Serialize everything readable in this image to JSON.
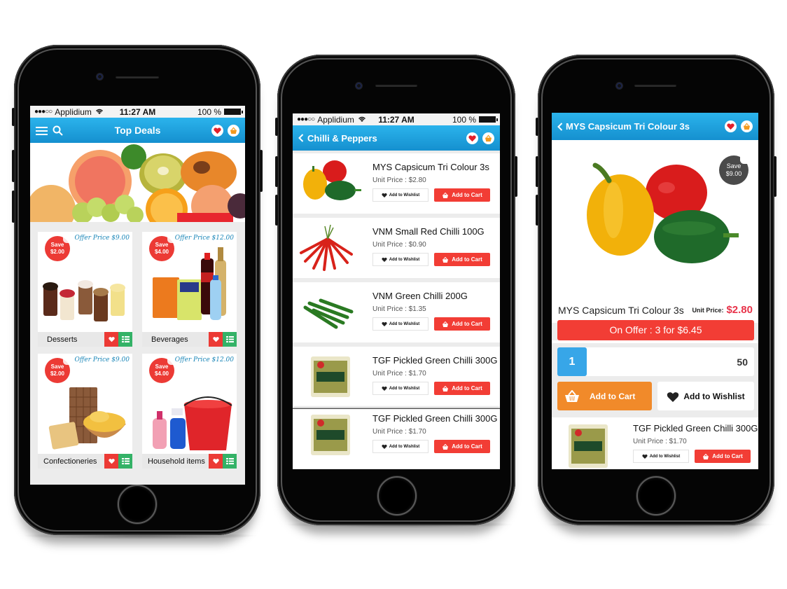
{
  "statusbar": {
    "signal": "●●●○○",
    "carrier": "Applidium",
    "time": "11:27 AM",
    "battery": "100 %"
  },
  "phone1": {
    "nav": {
      "title": "Top Deals",
      "menu_icon": "hamburger-menu-icon",
      "search_icon": "search-icon",
      "wishlist_icon": "heart-icon",
      "cart_icon": "basket-icon"
    },
    "tiles": [
      {
        "name": "Desserts",
        "offer": "Offer Price $9.00",
        "save_label": "Save",
        "save_amount": "$2.00"
      },
      {
        "name": "Beverages",
        "offer": "Offer Price $12.00",
        "save_label": "Save",
        "save_amount": "$4.00"
      },
      {
        "name": "Confectioneries",
        "offer": "Offer Price $9.00",
        "save_label": "Save",
        "save_amount": "$2.00"
      },
      {
        "name": "Household items",
        "offer": "Offer Price $12.00",
        "save_label": "Save",
        "save_amount": "$4.00"
      }
    ]
  },
  "phone2": {
    "nav": {
      "back": "<",
      "title": "Chilli & Peppers"
    },
    "products": [
      {
        "name": "MYS Capsicum Tri Colour 3s",
        "price": "Unit Price : $2.80",
        "wish": "Add to Wishlist",
        "cart": "Add to Cart"
      },
      {
        "name": "VNM Small Red Chilli 100G",
        "price": "Unit Price : $0.90",
        "wish": "Add to Wishlist",
        "cart": "Add to Cart"
      },
      {
        "name": "VNM Green Chilli 200G",
        "price": "Unit Price : $1.35",
        "wish": "Add to Wishlist",
        "cart": "Add to Cart"
      },
      {
        "name": "TGF Pickled Green Chilli 300G",
        "price": "Unit Price : $1.70",
        "wish": "Add to Wishlist",
        "cart": "Add to Cart"
      },
      {
        "name": "TGF Pickled Green Chilli 300G",
        "price": "Unit Price : $1.70",
        "wish": "Add to Wishlist",
        "cart": "Add to Cart"
      }
    ]
  },
  "phone3": {
    "nav": {
      "back": "<",
      "title": "MYS Capsicum Tri Colour 3s"
    },
    "save_label": "Save",
    "save_amount": "$9.00",
    "product_name": "MYS Capsicum Tri Colour 3s",
    "unit_price_label": "Unit Price:",
    "unit_price": "$2.80",
    "offer": "On Offer : 3 for $6.45",
    "quantity": "1",
    "max_quantity": "50",
    "add_to_cart": "Add to Cart",
    "add_to_wishlist": "Add to Wishlist",
    "related": {
      "name": "TGF Pickled Green Chilli 300G",
      "price": "Unit Price : $1.70",
      "wish": "Add to Wishlist",
      "cart": "Add to Cart"
    }
  },
  "colors": {
    "nav_blue": "#1a9ddc",
    "action_red": "#f23d35",
    "list_green": "#34b267",
    "cart_orange": "#f18a2a",
    "qty_blue": "#37a6e8",
    "price_red": "#e8334a"
  }
}
